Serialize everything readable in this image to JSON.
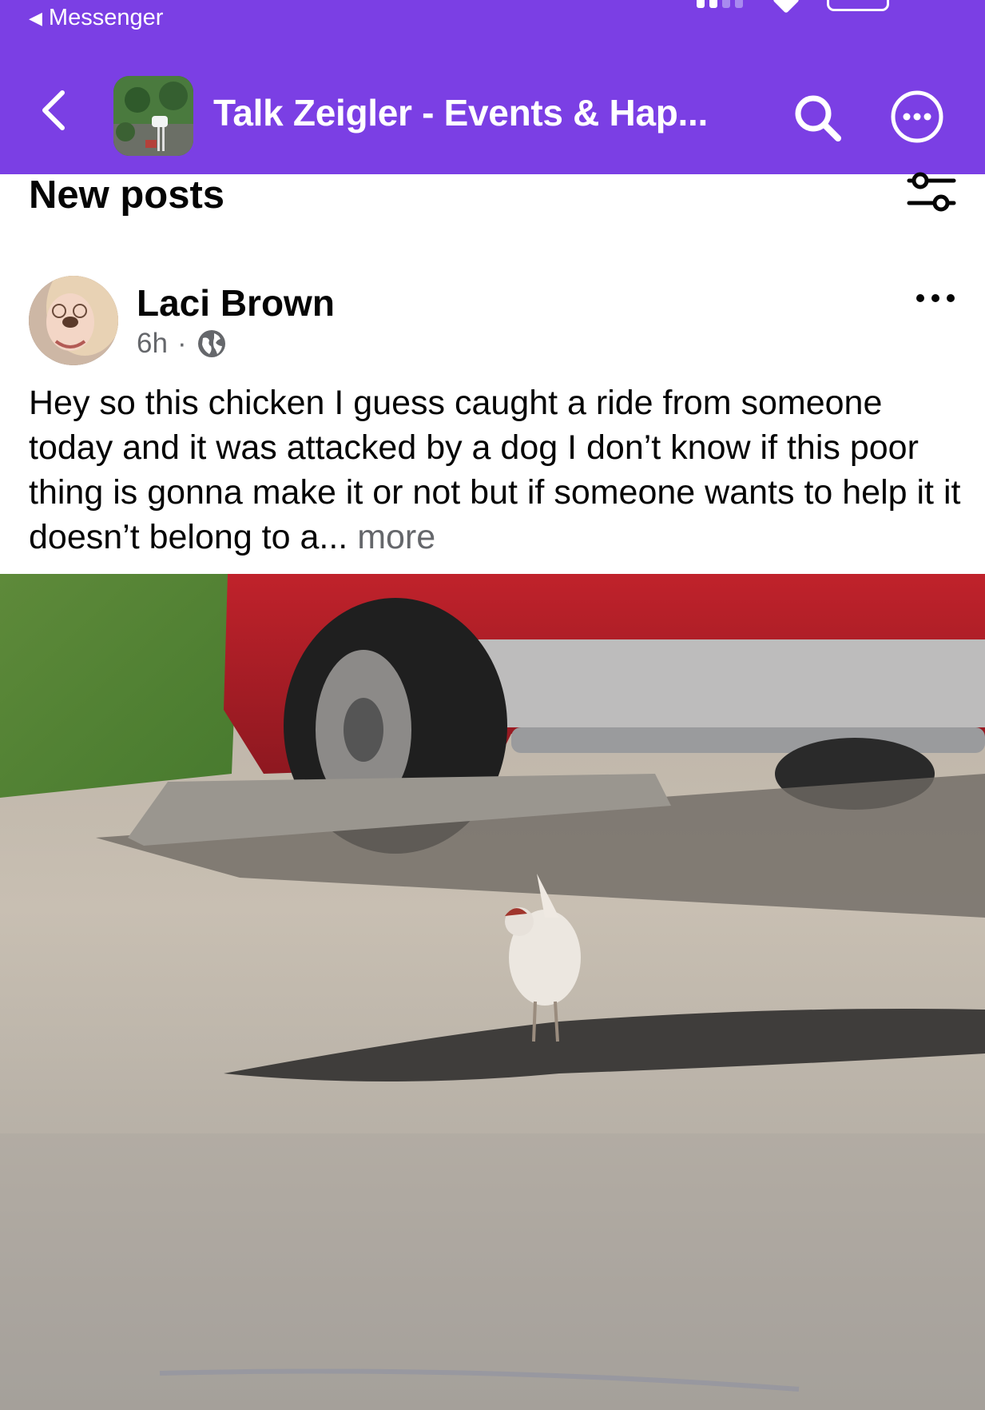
{
  "status_bar": {
    "back_app_label": "Messenger"
  },
  "header": {
    "group_name": "Talk Zeigler - Events & Hap...",
    "brand_color": "#7b3fe4"
  },
  "feed": {
    "section_title": "New posts"
  },
  "post": {
    "author": "Laci Brown",
    "time": "6h",
    "separator": "·",
    "text": "Hey so this chicken I guess caught a ride from someone today and it was attacked by a dog I don’t know if this poor thing is gonna make it or not but if someone wants to help it it doesn’t belong to a...",
    "see_more": "more"
  },
  "icons": {
    "back": "chevron-left-icon",
    "search": "search-icon",
    "more": "more-circle-icon",
    "filter": "filter-sliders-icon",
    "audience": "globe-icon",
    "post_options": "ellipsis-icon"
  }
}
